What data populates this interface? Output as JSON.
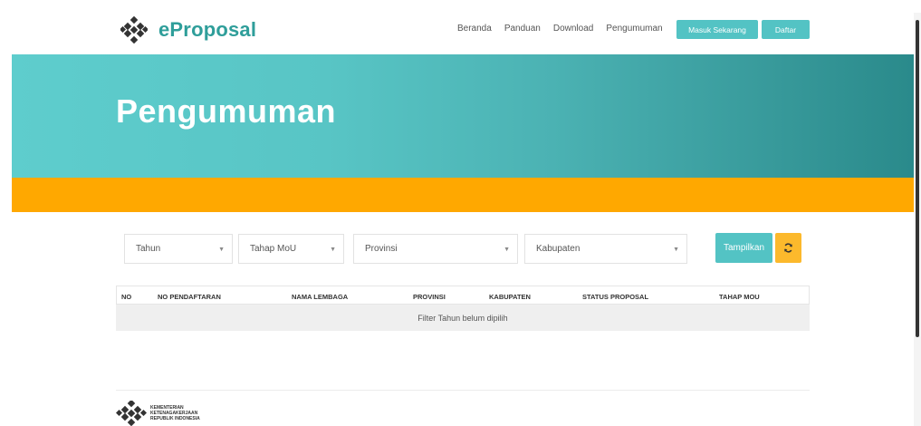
{
  "brand": {
    "name": "eProposal",
    "logo_icon": "kemnaker-logo-icon"
  },
  "nav": {
    "links": [
      "Beranda",
      "Panduan",
      "Download",
      "Pengumuman"
    ],
    "login_label": "Masuk Sekarang",
    "register_label": "Daftar"
  },
  "hero": {
    "title": "Pengumuman"
  },
  "filters": {
    "tahun": "Tahun",
    "tahap_mou": "Tahap MoU",
    "provinsi": "Provinsi",
    "kabupaten": "Kabupaten",
    "submit_label": "Tampilkan",
    "refresh_icon": "refresh-icon"
  },
  "table": {
    "columns": [
      "NO",
      "NO PENDAFTARAN",
      "NAMA LEMBAGA",
      "PROVINSI",
      "KABUPATEN",
      "STATUS PROPOSAL",
      "TAHAP MOU"
    ],
    "empty_message": "Filter Tahun belum dipilih"
  },
  "footer": {
    "org_lines": [
      "KEMENTERIAN",
      "KETENAGAKERJAAN",
      "REPUBLIK INDONESIA"
    ]
  },
  "colors": {
    "brand_teal": "#53c3c4",
    "brand_text": "#2f9e9a",
    "accent_orange": "#ffa800",
    "refresh_yellow": "#fcb92c"
  }
}
